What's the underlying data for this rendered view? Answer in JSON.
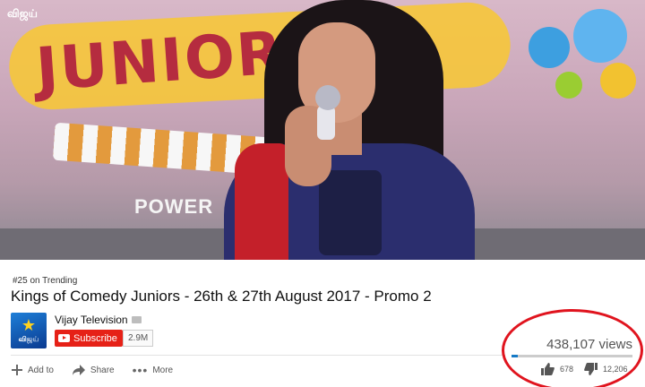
{
  "video": {
    "watermark": "விஜய்",
    "logo_text": "JUNIORS",
    "stage_text": "POWER"
  },
  "badge": {
    "trending": "#25 on Trending"
  },
  "title": "Kings of Comedy Juniors - 26th & 27th August 2017 - Promo 2",
  "channel": {
    "name": "Vijay Television",
    "logo_text": "விஜய்",
    "subscribe_label": "Subscribe",
    "subscriber_count": "2.9M"
  },
  "stats": {
    "views": "438,107 views",
    "likes": "678",
    "dislikes": "12,206",
    "like_ratio": 0.053
  },
  "actions": {
    "add_to": "Add to",
    "share": "Share",
    "more": "More"
  },
  "colors": {
    "subscribe": "#e62117",
    "sentiment": "#167ac6",
    "annotation_circle": "#e0141e"
  }
}
